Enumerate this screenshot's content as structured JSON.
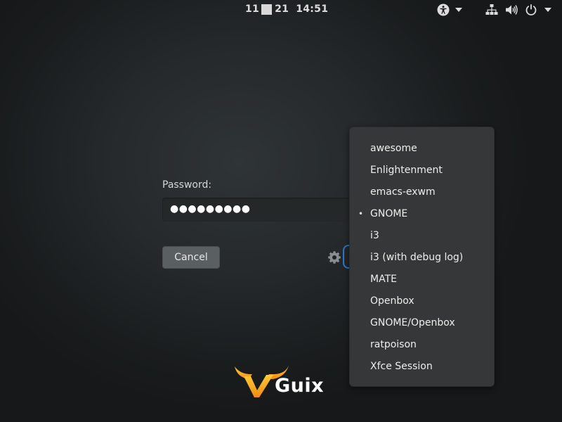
{
  "topbar": {
    "date_left": "11",
    "date_right": "21",
    "time": "14:51"
  },
  "login": {
    "password_label": "Password:",
    "password_mask": "●●●●●●●●●",
    "cancel_label": "Cancel"
  },
  "session_menu": {
    "selected": "GNOME",
    "items": [
      {
        "label": "awesome"
      },
      {
        "label": "Enlightenment"
      },
      {
        "label": "emacs-exwm"
      },
      {
        "label": "GNOME",
        "bullet": "•"
      },
      {
        "label": "i3"
      },
      {
        "label": "i3 (with debug log)"
      },
      {
        "label": "MATE"
      },
      {
        "label": "Openbox"
      },
      {
        "label": "GNOME/Openbox"
      },
      {
        "label": "ratpoison"
      },
      {
        "label": "Xfce Session"
      }
    ]
  },
  "branding": {
    "logo_text": "Guix",
    "accent_color": "#f0a028",
    "focus_color": "#2a76c6"
  },
  "icons": [
    "accessibility-icon",
    "chevron-down-icon",
    "network-icon",
    "volume-icon",
    "power-icon",
    "gear-icon"
  ]
}
